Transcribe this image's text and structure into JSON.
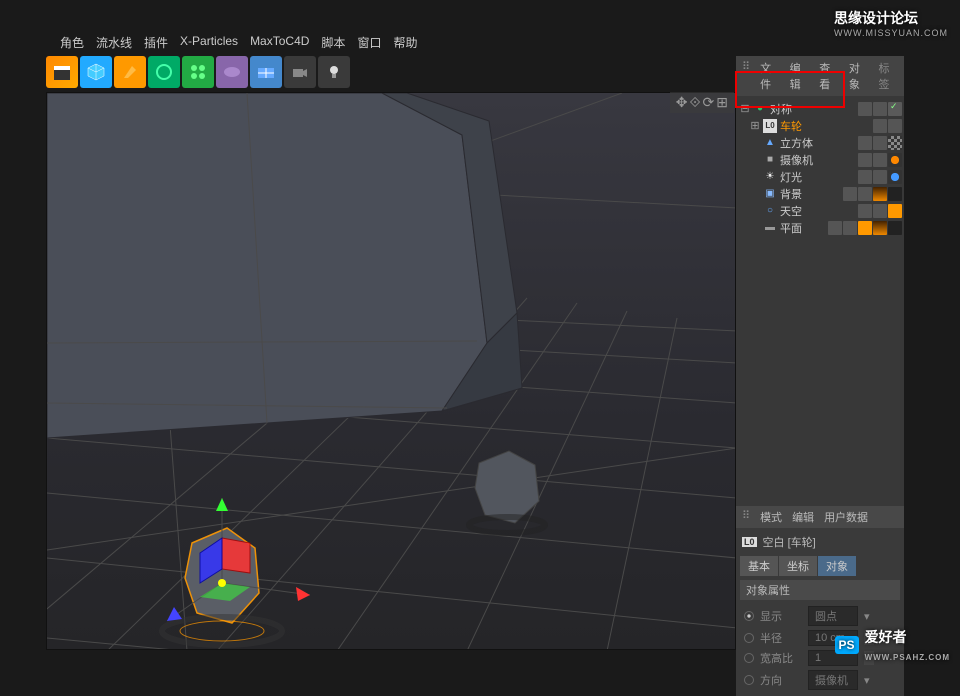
{
  "watermarks": {
    "top_title": "思缘设计论坛",
    "top_url": "WWW.MISSYUAN.COM",
    "bot_ps": "PS",
    "bot_txt": "爱好者",
    "bot_url": "WWW.PSAHZ.COM"
  },
  "menu": {
    "items": [
      "角色",
      "流水线",
      "插件",
      "X-Particles",
      "MaxToC4D",
      "脚本",
      "窗口",
      "帮助"
    ]
  },
  "object_panel": {
    "tabs": [
      "文件",
      "编辑",
      "查看",
      "对象",
      "标签"
    ],
    "tree": [
      {
        "exp": "⊟",
        "icon": "●",
        "iconColor": "#2c6",
        "label": "对称",
        "tags": [
          "g",
          "g",
          "check"
        ]
      },
      {
        "exp": "⊞",
        "indent": 1,
        "iconTxt": "L0",
        "iconBg": "#eee",
        "label": "车轮",
        "labelClass": "orange",
        "tags": [
          "g",
          "g"
        ]
      },
      {
        "indent": 0,
        "icon": "▲",
        "iconColor": "#5af",
        "label": "立方体",
        "tags": [
          "g",
          "g",
          "chk"
        ]
      },
      {
        "indent": 0,
        "icon": "■",
        "iconColor": "#999",
        "label": "摄像机",
        "tags": [
          "g",
          "g",
          "noentry"
        ]
      },
      {
        "indent": 0,
        "icon": "☀",
        "iconColor": "#eee",
        "label": "灯光",
        "tags": [
          "g",
          "g",
          "blue"
        ]
      },
      {
        "indent": 0,
        "icon": "▣",
        "iconColor": "#8bf",
        "label": "背景",
        "tags": [
          "g",
          "g",
          "film",
          "dark"
        ]
      },
      {
        "indent": 0,
        "icon": "○",
        "iconColor": "#6af",
        "label": "天空",
        "tags": [
          "g",
          "g",
          "orange"
        ]
      },
      {
        "indent": 0,
        "icon": "▬",
        "iconColor": "#888",
        "label": "平面",
        "tags": [
          "g",
          "g",
          "orange",
          "film",
          "dark"
        ]
      }
    ]
  },
  "attributes": {
    "tabs": [
      "模式",
      "编辑",
      "用户数据"
    ],
    "title_icon": "L0",
    "title": "空白 [车轮]",
    "subtabs": [
      "基本",
      "坐标",
      "对象"
    ],
    "section_title": "对象属性",
    "rows": [
      {
        "type": "radio",
        "label": "显示",
        "value": "圆点"
      },
      {
        "type": "radio",
        "label": "半径",
        "value": "10 cm"
      },
      {
        "type": "radio",
        "label": "宽高比",
        "value": "1"
      },
      {
        "type": "radio",
        "label": "方向",
        "value": "摄像机"
      }
    ]
  }
}
